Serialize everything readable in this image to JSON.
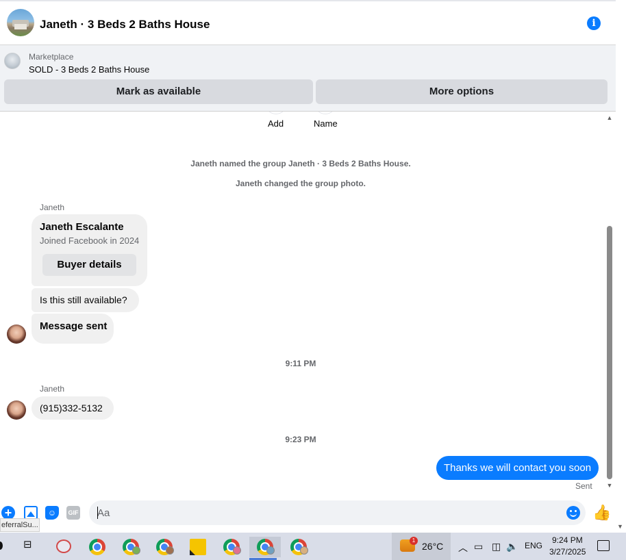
{
  "header": {
    "title": "Janeth · 3 Beds 2 Baths House",
    "info_icon": "i"
  },
  "marketplace": {
    "label": "Marketplace",
    "item": "SOLD - 3 Beds 2 Baths House",
    "mark_available": "Mark as available",
    "more_options": "More options"
  },
  "chat": {
    "actions": [
      "Add",
      "Name"
    ],
    "system_messages": [
      "Janeth named the group Janeth · 3 Beds 2 Baths House.",
      "Janeth changed the group photo."
    ],
    "sender1": "Janeth",
    "card": {
      "name": "Janeth Escalante",
      "subtitle": "Joined Facebook in 2024",
      "button": "Buyer details"
    },
    "msg_available": "Is this still available?",
    "msg_sent": "Message sent",
    "time1": "9:11 PM",
    "sender2": "Janeth",
    "msg_phone": "(915)332-5132",
    "time2": "9:23 PM",
    "outgoing": "Thanks we will contact you soon",
    "status": "Sent"
  },
  "composer": {
    "placeholder": "Aa",
    "gif_label": "GIF",
    "plus": "+",
    "like": "👍",
    "tooltip": "eferralSu..."
  },
  "taskbar": {
    "weather_badge": "1",
    "temperature": "26°C",
    "language": "ENG",
    "time": "9:24 PM",
    "date": "3/27/2025",
    "tray_icons": [
      "chevron-up-icon",
      "network-icon",
      "meet-icon",
      "volume-icon"
    ]
  },
  "colors": {
    "accent": "#0a7cff",
    "bubble_gray": "#f0f0f0",
    "taskbar": "#d9dde8"
  }
}
